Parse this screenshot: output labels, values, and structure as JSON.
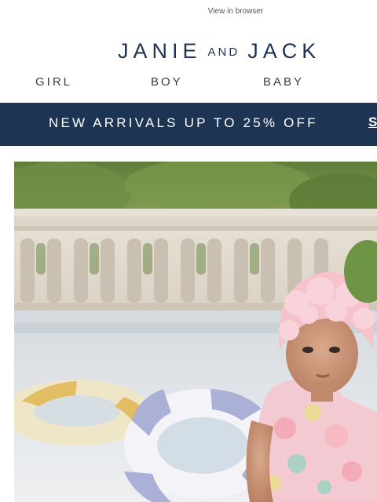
{
  "header": {
    "view_in_browser": "View in browser"
  },
  "logo": {
    "word1": "JANIE",
    "word_and": "AND",
    "word2": "JACK"
  },
  "nav": {
    "items": [
      {
        "label": "GIRL"
      },
      {
        "label": "BOY"
      },
      {
        "label": "BABY"
      }
    ]
  },
  "banner": {
    "text": "NEW ARRIVALS UP TO 25% OFF",
    "link": "S"
  },
  "colors": {
    "brand_navy": "#1d3453",
    "nav_text": "#3d3d3d"
  },
  "hero": {
    "icon": "hero-photo-girl-pool-float"
  }
}
